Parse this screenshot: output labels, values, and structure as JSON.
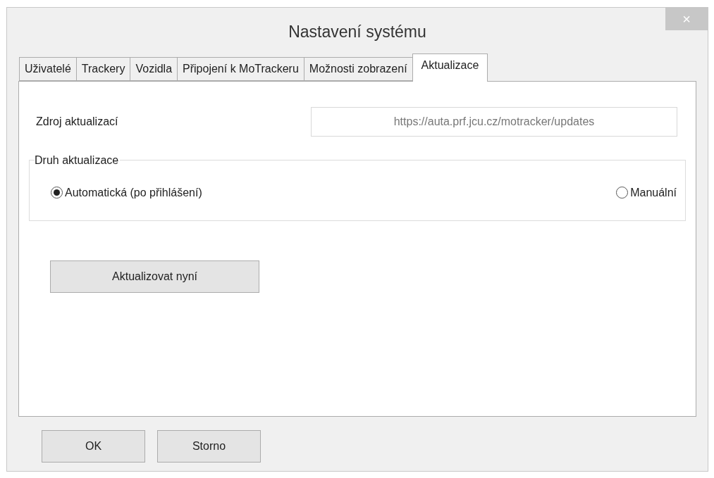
{
  "window": {
    "title": "Nastavení systému",
    "close": "×"
  },
  "tabs": [
    {
      "label": "Uživatelé",
      "selected": false
    },
    {
      "label": "Trackery",
      "selected": false
    },
    {
      "label": "Vozidla",
      "selected": false
    },
    {
      "label": "Připojení k MoTrackeru",
      "selected": false
    },
    {
      "label": "Možnosti zobrazení",
      "selected": false
    },
    {
      "label": "Aktualizace",
      "selected": true
    }
  ],
  "source": {
    "label": "Zdroj aktualizací",
    "value": "https://auta.prf.jcu.cz/motracker/updates"
  },
  "update_type": {
    "legend": "Druh aktualizace",
    "options": [
      {
        "label": "Automatická (po přihlášení)",
        "selected": true
      },
      {
        "label": "Manuální",
        "selected": false
      }
    ]
  },
  "update_button": "Aktualizovat nyní",
  "buttons": [
    "OK",
    "Storno"
  ]
}
